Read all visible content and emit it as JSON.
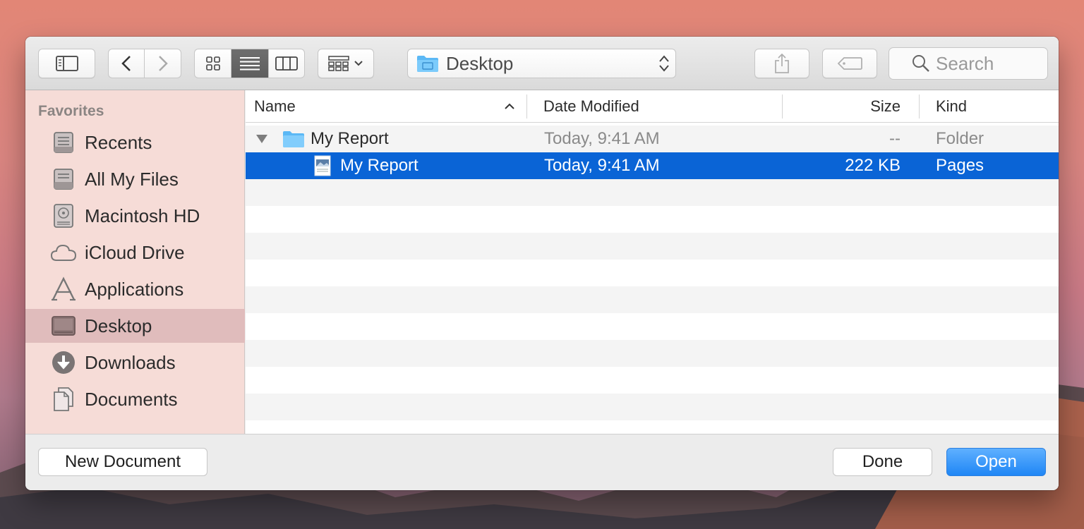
{
  "toolbar": {
    "location": "Desktop",
    "search_placeholder": "Search"
  },
  "sidebar": {
    "heading": "Favorites",
    "items": [
      {
        "label": "Recents",
        "icon": "recents-icon"
      },
      {
        "label": "All My Files",
        "icon": "all-files-icon"
      },
      {
        "label": "Macintosh HD",
        "icon": "hard-drive-icon"
      },
      {
        "label": "iCloud Drive",
        "icon": "cloud-icon"
      },
      {
        "label": "Applications",
        "icon": "applications-icon"
      },
      {
        "label": "Desktop",
        "icon": "desktop-icon",
        "selected": true
      },
      {
        "label": "Downloads",
        "icon": "download-icon"
      },
      {
        "label": "Documents",
        "icon": "documents-icon"
      }
    ]
  },
  "columns": {
    "name": "Name",
    "date": "Date Modified",
    "size": "Size",
    "kind": "Kind"
  },
  "files": [
    {
      "name": "My Report",
      "date": "Today,  9:41 AM",
      "size": "--",
      "kind": "Folder",
      "type": "folder",
      "expanded": true
    },
    {
      "name": "My Report",
      "date": "Today,  9:41 AM",
      "size": "222 KB",
      "kind": "Pages",
      "type": "document",
      "selected": true
    }
  ],
  "footer": {
    "new_document": "New Document",
    "done": "Done",
    "open": "Open"
  },
  "colors": {
    "selection": "#0a64d6",
    "sidebar_bg": "#f6dcd7",
    "sidebar_selected": "#e0bcbc",
    "primary_button": "#1f86f5"
  }
}
